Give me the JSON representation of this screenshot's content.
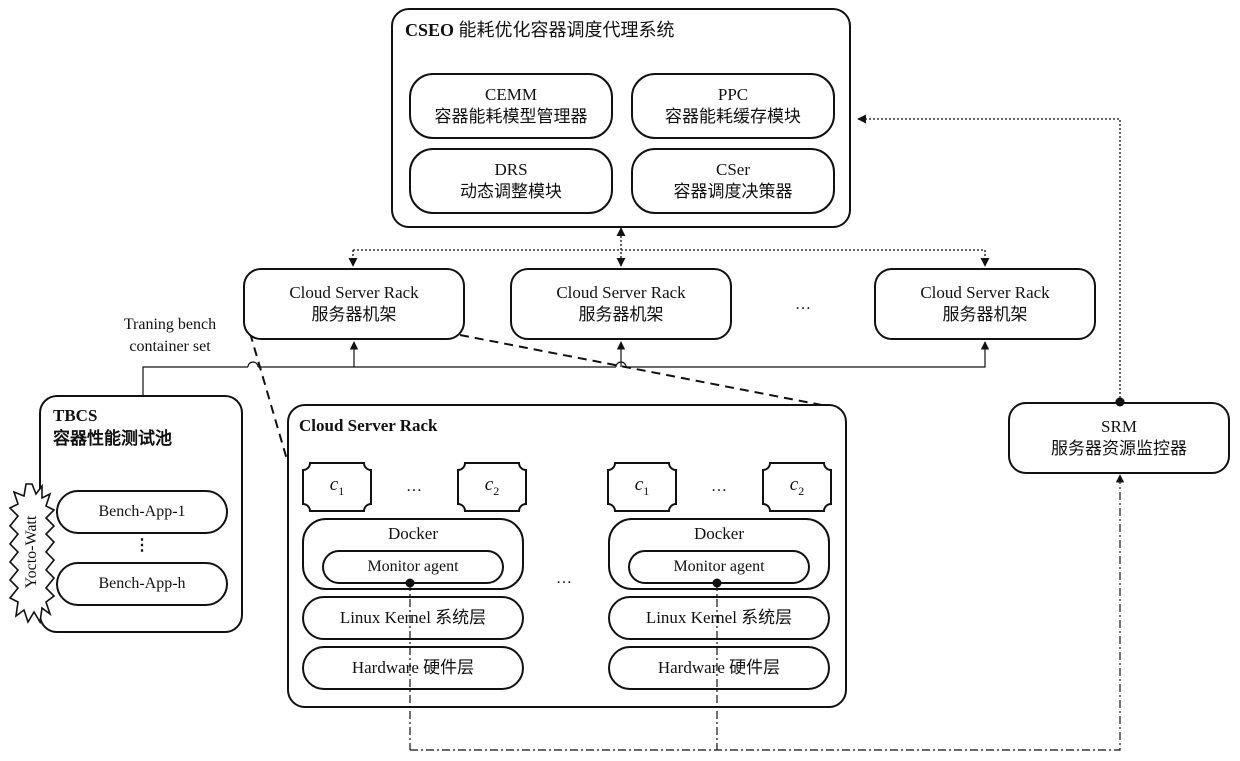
{
  "cseo": {
    "abbr": "CSEO",
    "title": "能耗优化容器调度代理系统",
    "modules": [
      {
        "abbr": "CEMM",
        "name": "容器能耗模型管理器"
      },
      {
        "abbr": "PPC",
        "name": "容器能耗缓存模块"
      },
      {
        "abbr": "DRS",
        "name": "动态调整模块"
      },
      {
        "abbr": "CSer",
        "name": "容器调度决策器"
      }
    ]
  },
  "racks": [
    {
      "title": "Cloud Server Rack",
      "subtitle": "服务器机架"
    },
    {
      "title": "Cloud Server Rack",
      "subtitle": "服务器机架"
    },
    {
      "title": "Cloud Server Rack",
      "subtitle": "服务器机架"
    }
  ],
  "rack_ellipsis": "…",
  "training_label": {
    "line1": "Traning bench",
    "line2": "container set"
  },
  "tbcs": {
    "abbr": "TBCS",
    "name": "容器性能测试池",
    "apps": [
      "Bench-App-1",
      "Bench-App-h"
    ],
    "apps_ellipsis": "⋮",
    "meter": "Yocto-Watt"
  },
  "rack_detail": {
    "title": "Cloud Server Rack",
    "hosts": [
      {
        "containers": [
          {
            "var": "c",
            "sub": "1"
          },
          {
            "var": "c",
            "sub": "2"
          }
        ],
        "container_ellipsis": "…",
        "docker": "Docker",
        "agent": "Monitor agent",
        "kernel": "Linux Kernel 系统层",
        "hardware": "Hardware 硬件层"
      },
      {
        "containers": [
          {
            "var": "c",
            "sub": "1"
          },
          {
            "var": "c",
            "sub": "2"
          }
        ],
        "container_ellipsis": "…",
        "docker": "Docker",
        "agent": "Monitor agent",
        "kernel": "Linux Kernel 系统层",
        "hardware": "Hardware 硬件层"
      }
    ],
    "host_ellipsis": "…"
  },
  "srm": {
    "abbr": "SRM",
    "name": "服务器资源监控器"
  }
}
